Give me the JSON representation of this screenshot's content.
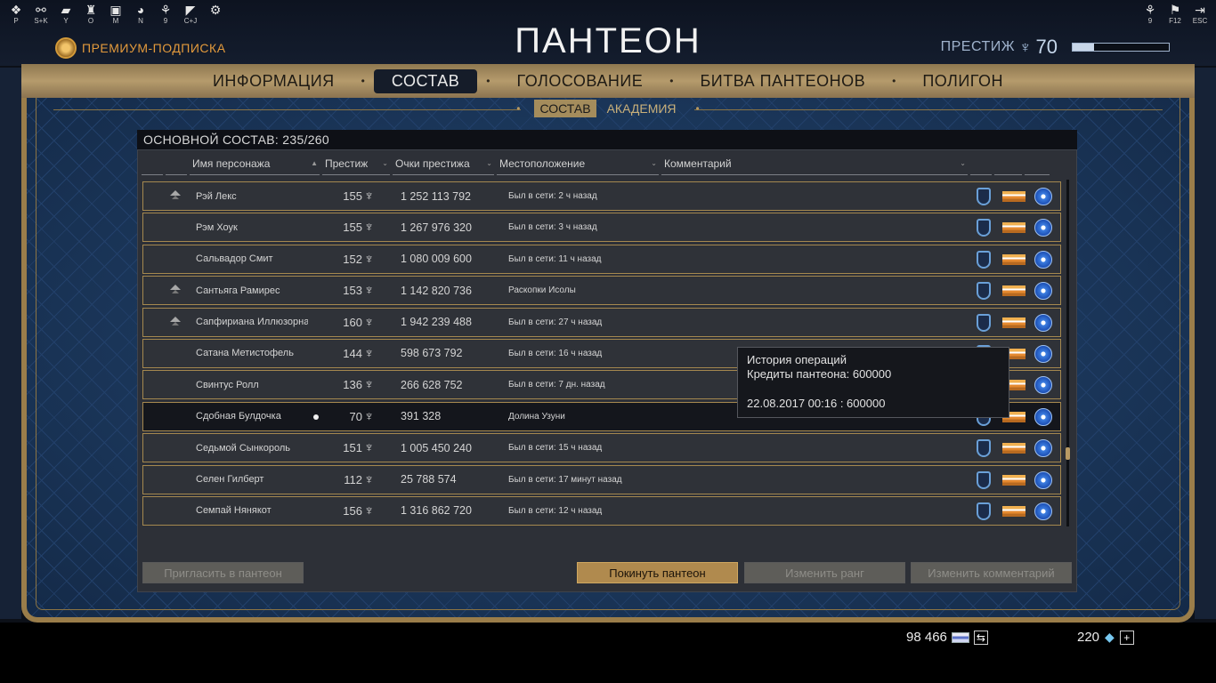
{
  "hotkeys_left": [
    {
      "icon": "gear-cluster-icon",
      "glyph": "❖",
      "key": "P"
    },
    {
      "icon": "link-icon",
      "glyph": "⚯",
      "key": "S+K"
    },
    {
      "icon": "chat-icon",
      "glyph": "▰",
      "key": "Y"
    },
    {
      "icon": "clan-icon",
      "glyph": "♜",
      "key": "O"
    },
    {
      "icon": "market-icon",
      "glyph": "▣",
      "key": "M"
    },
    {
      "icon": "mask-icon",
      "glyph": "◕",
      "key": "N"
    },
    {
      "icon": "wolf-icon",
      "glyph": "⚘",
      "key": "9"
    },
    {
      "icon": "bird-icon",
      "glyph": "◤",
      "key": "C+J"
    },
    {
      "icon": "settings-icon",
      "glyph": "⚙",
      "key": ""
    }
  ],
  "hotkeys_right": [
    {
      "icon": "wolf-icon",
      "glyph": "⚘",
      "key": "9"
    },
    {
      "icon": "flag-icon",
      "glyph": "⚑",
      "key": "F12"
    },
    {
      "icon": "exit-icon",
      "glyph": "⇥",
      "key": "ESC"
    }
  ],
  "premium_label": "ПРЕМИУМ-ПОДПИСКА",
  "page_title": "ПАНТЕОН",
  "prestige": {
    "label": "ПРЕСТИЖ",
    "value": "70",
    "progress": 0.22
  },
  "tabs": [
    {
      "label": "ИНФОРМАЦИЯ",
      "active": false
    },
    {
      "label": "СОСТАВ",
      "active": true
    },
    {
      "label": "ГОЛОСОВАНИЕ",
      "active": false
    },
    {
      "label": "БИТВА ПАНТЕОНОВ",
      "active": false
    },
    {
      "label": "ПОЛИГОН",
      "active": false
    }
  ],
  "subtabs": [
    {
      "label": "СОСТАВ",
      "active": true
    },
    {
      "label": "АКАДЕМИЯ",
      "active": false
    }
  ],
  "roster_title": "ОСНОВНОЙ СОСТАВ: 235/260",
  "columns": [
    {
      "label": "",
      "w": 24
    },
    {
      "label": "",
      "w": 24
    },
    {
      "label": "Имя персонажа",
      "w": 146,
      "arrow": "▲"
    },
    {
      "label": "Престиж",
      "w": 76,
      "arrow": "⌄"
    },
    {
      "label": "Очки престижа",
      "w": 114,
      "arrow": "⌄"
    },
    {
      "label": "Местоположение",
      "w": 182,
      "arrow": "⌄"
    },
    {
      "label": "Комментарий",
      "w": 344,
      "arrow": "⌄"
    },
    {
      "label": "",
      "w": 24
    },
    {
      "label": "",
      "w": 31
    },
    {
      "label": "",
      "w": 28
    }
  ],
  "rows": [
    {
      "rank_up": true,
      "name": "Рэй Лекс",
      "online": false,
      "mr": "155",
      "points": "1 252 113 792",
      "location": "Был в сети: 2 ч назад",
      "selected": false
    },
    {
      "rank_up": false,
      "name": "Рэм Хоук",
      "online": false,
      "mr": "155",
      "points": "1 267 976 320",
      "location": "Был в сети: 3 ч назад",
      "selected": false
    },
    {
      "rank_up": false,
      "name": "Сальвадор Смит",
      "online": false,
      "mr": "152",
      "points": "1 080 009 600",
      "location": "Был в сети: 11 ч назад",
      "selected": false
    },
    {
      "rank_up": true,
      "name": "Сантьяга Рамирес",
      "online": false,
      "mr": "153",
      "points": "1 142 820 736",
      "location": "Раскопки Исолы",
      "selected": false
    },
    {
      "rank_up": true,
      "name": "Сапфириана Иллюзорная",
      "online": false,
      "mr": "160",
      "points": "1 942 239 488",
      "location": "Был в сети: 27 ч назад",
      "selected": false
    },
    {
      "rank_up": false,
      "name": "Сатана Метистофель",
      "online": false,
      "mr": "144",
      "points": "598 673 792",
      "location": "Был в сети: 16 ч назад",
      "selected": false
    },
    {
      "rank_up": false,
      "name": "Свинтус Ролл",
      "online": false,
      "mr": "136",
      "points": "266 628 752",
      "location": "Был в сети: 7 дн. назад",
      "selected": false
    },
    {
      "rank_up": false,
      "name": "Сдобная Булдочка",
      "online": true,
      "mr": "70",
      "points": "391 328",
      "location": "Долина Узуни",
      "selected": true
    },
    {
      "rank_up": false,
      "name": "Седьмой Сынкороль",
      "online": false,
      "mr": "151",
      "points": "1 005 450 240",
      "location": "Был в сети: 15 ч назад",
      "selected": false
    },
    {
      "rank_up": false,
      "name": "Селен Гилберт",
      "online": false,
      "mr": "112",
      "points": "25 788 574",
      "location": "Был в сети: 17 минут назад",
      "selected": false
    },
    {
      "rank_up": false,
      "name": "Семпай Нянякот",
      "online": false,
      "mr": "156",
      "points": "1 316 862 720",
      "location": "Был в сети: 12 ч назад",
      "selected": false
    }
  ],
  "buttons": {
    "invite": "Пригласить в пантеон",
    "leave": "Покинуть пантеон",
    "change_rank": "Изменить ранг",
    "change_comment": "Изменить комментарий"
  },
  "tooltip": {
    "title": "История операций",
    "line1": "Кредиты пантеона: 600000",
    "line2": "22.08.2017 00:16 : 600000"
  },
  "currency": {
    "credits": "98 466",
    "platinum": "220"
  }
}
